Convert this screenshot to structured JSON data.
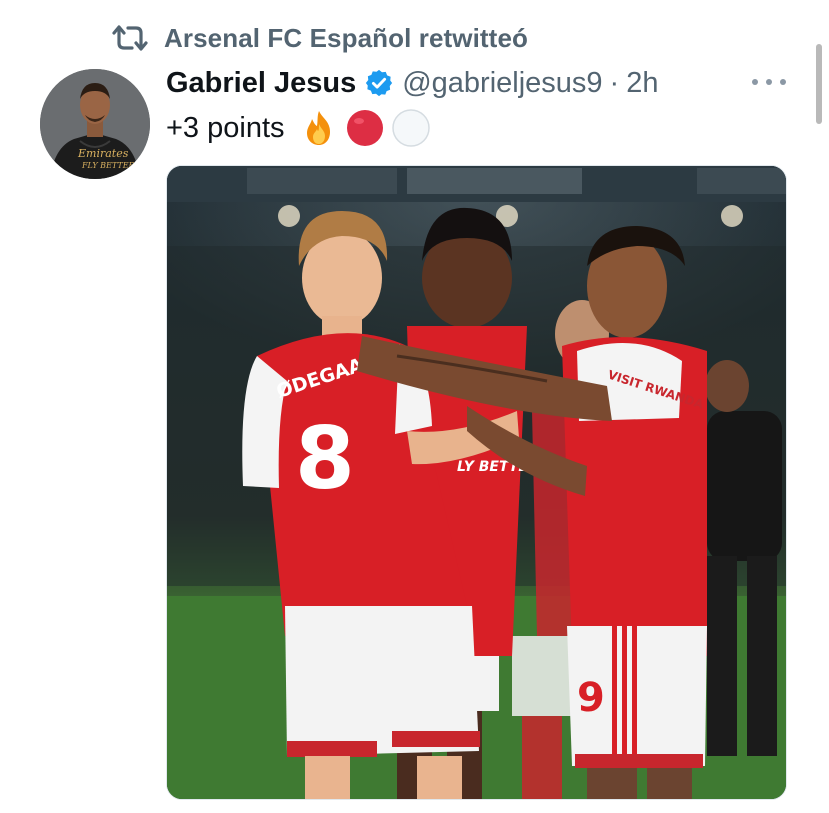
{
  "retweet": {
    "icon": "retweet-icon",
    "label": "Arsenal FC Español retwitteó"
  },
  "tweet": {
    "author": {
      "display_name": "Gabriel Jesus",
      "verified": true,
      "handle": "@gabrieljesus9",
      "separator": "·",
      "time": "2h"
    },
    "text": "+3 points",
    "emojis": [
      "fire-emoji",
      "red-circle-emoji",
      "white-circle-emoji"
    ],
    "media": {
      "description_icon": "photo",
      "player_left": {
        "name": "ØDEGAARD",
        "number": "8"
      },
      "player_right": {
        "number": "9",
        "sleeve_text": "VISIT RWANDA"
      },
      "shirt_sponsor": "Fly Better"
    }
  },
  "colors": {
    "text_primary": "#0f1419",
    "text_secondary": "#536471",
    "verified_blue": "#1d9bf0",
    "arsenal_red": "#d81f26"
  }
}
